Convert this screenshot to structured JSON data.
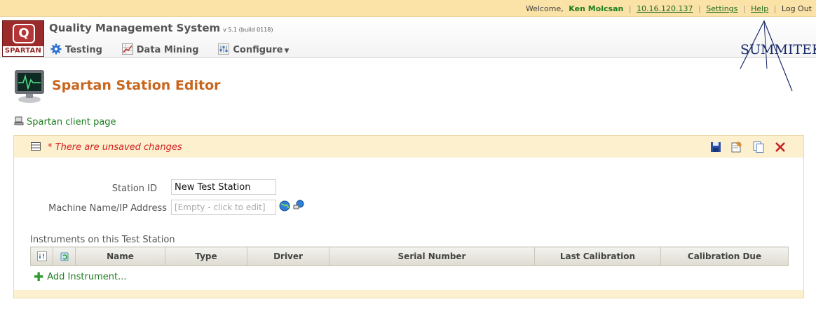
{
  "topbar": {
    "welcome": "Welcome,",
    "user": "Ken Molcsan",
    "ip": "10.16.120.137",
    "settings": "Settings",
    "help": "Help",
    "logout": "Log Out"
  },
  "app": {
    "logo_letter": "Q",
    "logo_text": "SPARTAN",
    "name": "Quality Management System",
    "version": "v 5.1 (build 0118)",
    "vendor_logo": "SUMMITEK"
  },
  "nav": {
    "testing": "Testing",
    "data_mining": "Data Mining",
    "configure": "Configure"
  },
  "page": {
    "title": "Spartan Station Editor",
    "client_link": "Spartan client page"
  },
  "panel": {
    "unsaved": "* There are unsaved changes",
    "tools": [
      "save-icon",
      "edit-notes-icon",
      "copy-icon",
      "close-icon"
    ]
  },
  "form": {
    "station_id_label": "Station ID",
    "station_id_value": "New Test Station",
    "machine_label": "Machine Name/IP Address",
    "machine_placeholder": "[Empty - click to edit]"
  },
  "instruments": {
    "section_label": "Instruments on this Test Station",
    "columns": [
      "Name",
      "Type",
      "Driver",
      "Serial Number",
      "Last Calibration",
      "Calibration Due"
    ],
    "rows": [],
    "add_label": "Add Instrument..."
  },
  "colors": {
    "accent_title": "#c8661e",
    "link_green": "#1e7d1e",
    "alert_red": "#d22020",
    "topbar_bg": "#fbe3a8",
    "brand_red": "#9b2a2a"
  }
}
